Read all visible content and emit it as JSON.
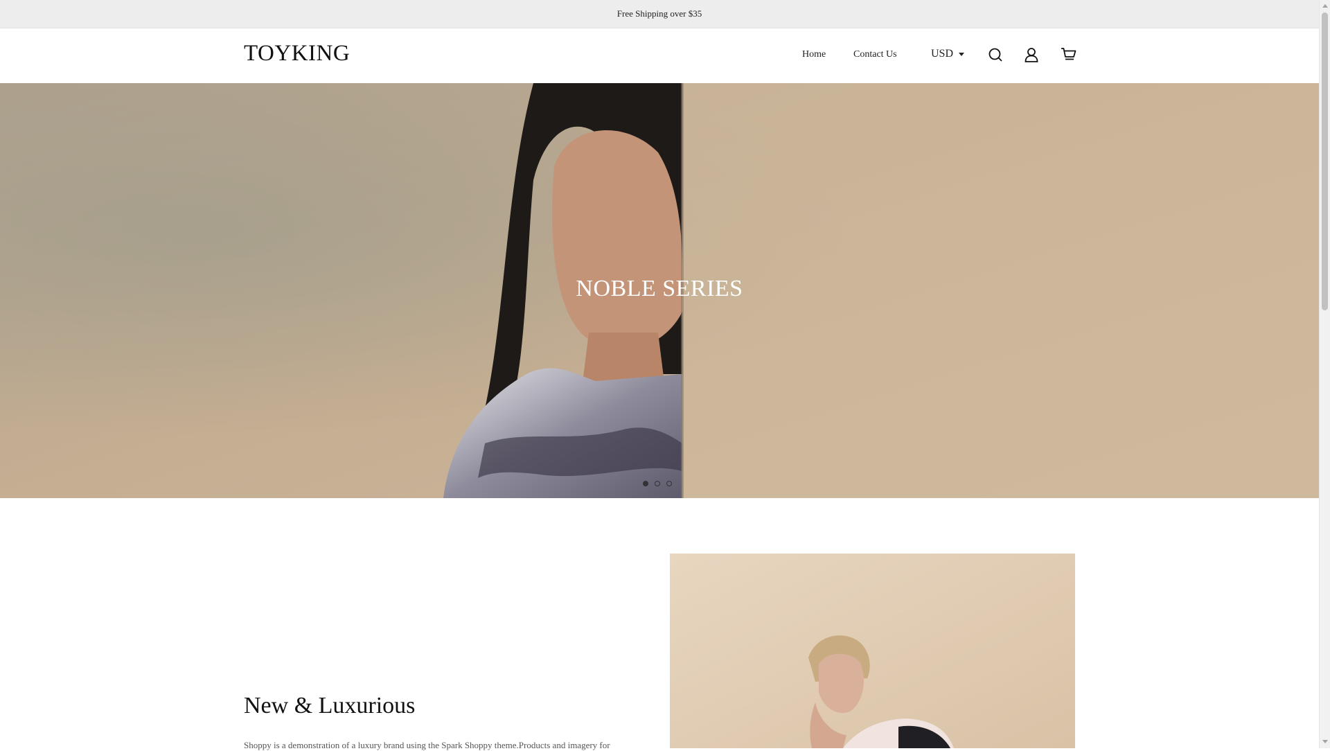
{
  "announcement": {
    "text": "Free Shipping over $35"
  },
  "header": {
    "logo": "TOYKING",
    "nav": [
      {
        "label": "Home"
      },
      {
        "label": "Contact Us"
      }
    ],
    "currency": {
      "selected": "USD"
    },
    "icons": [
      "search-icon",
      "account-icon",
      "cart-icon"
    ]
  },
  "hero": {
    "title": "NOBLE SERIES",
    "slides_total": 3,
    "active_slide": 1
  },
  "feature": {
    "heading": "New & Luxurious",
    "text": "Shoppy is a demonstration of a luxury brand using the Spark Shoppy theme.Products and imagery for"
  },
  "colors": {
    "announcement_bg": "#ededed",
    "text": "#111111",
    "hero_bg": "#c8b49c"
  }
}
